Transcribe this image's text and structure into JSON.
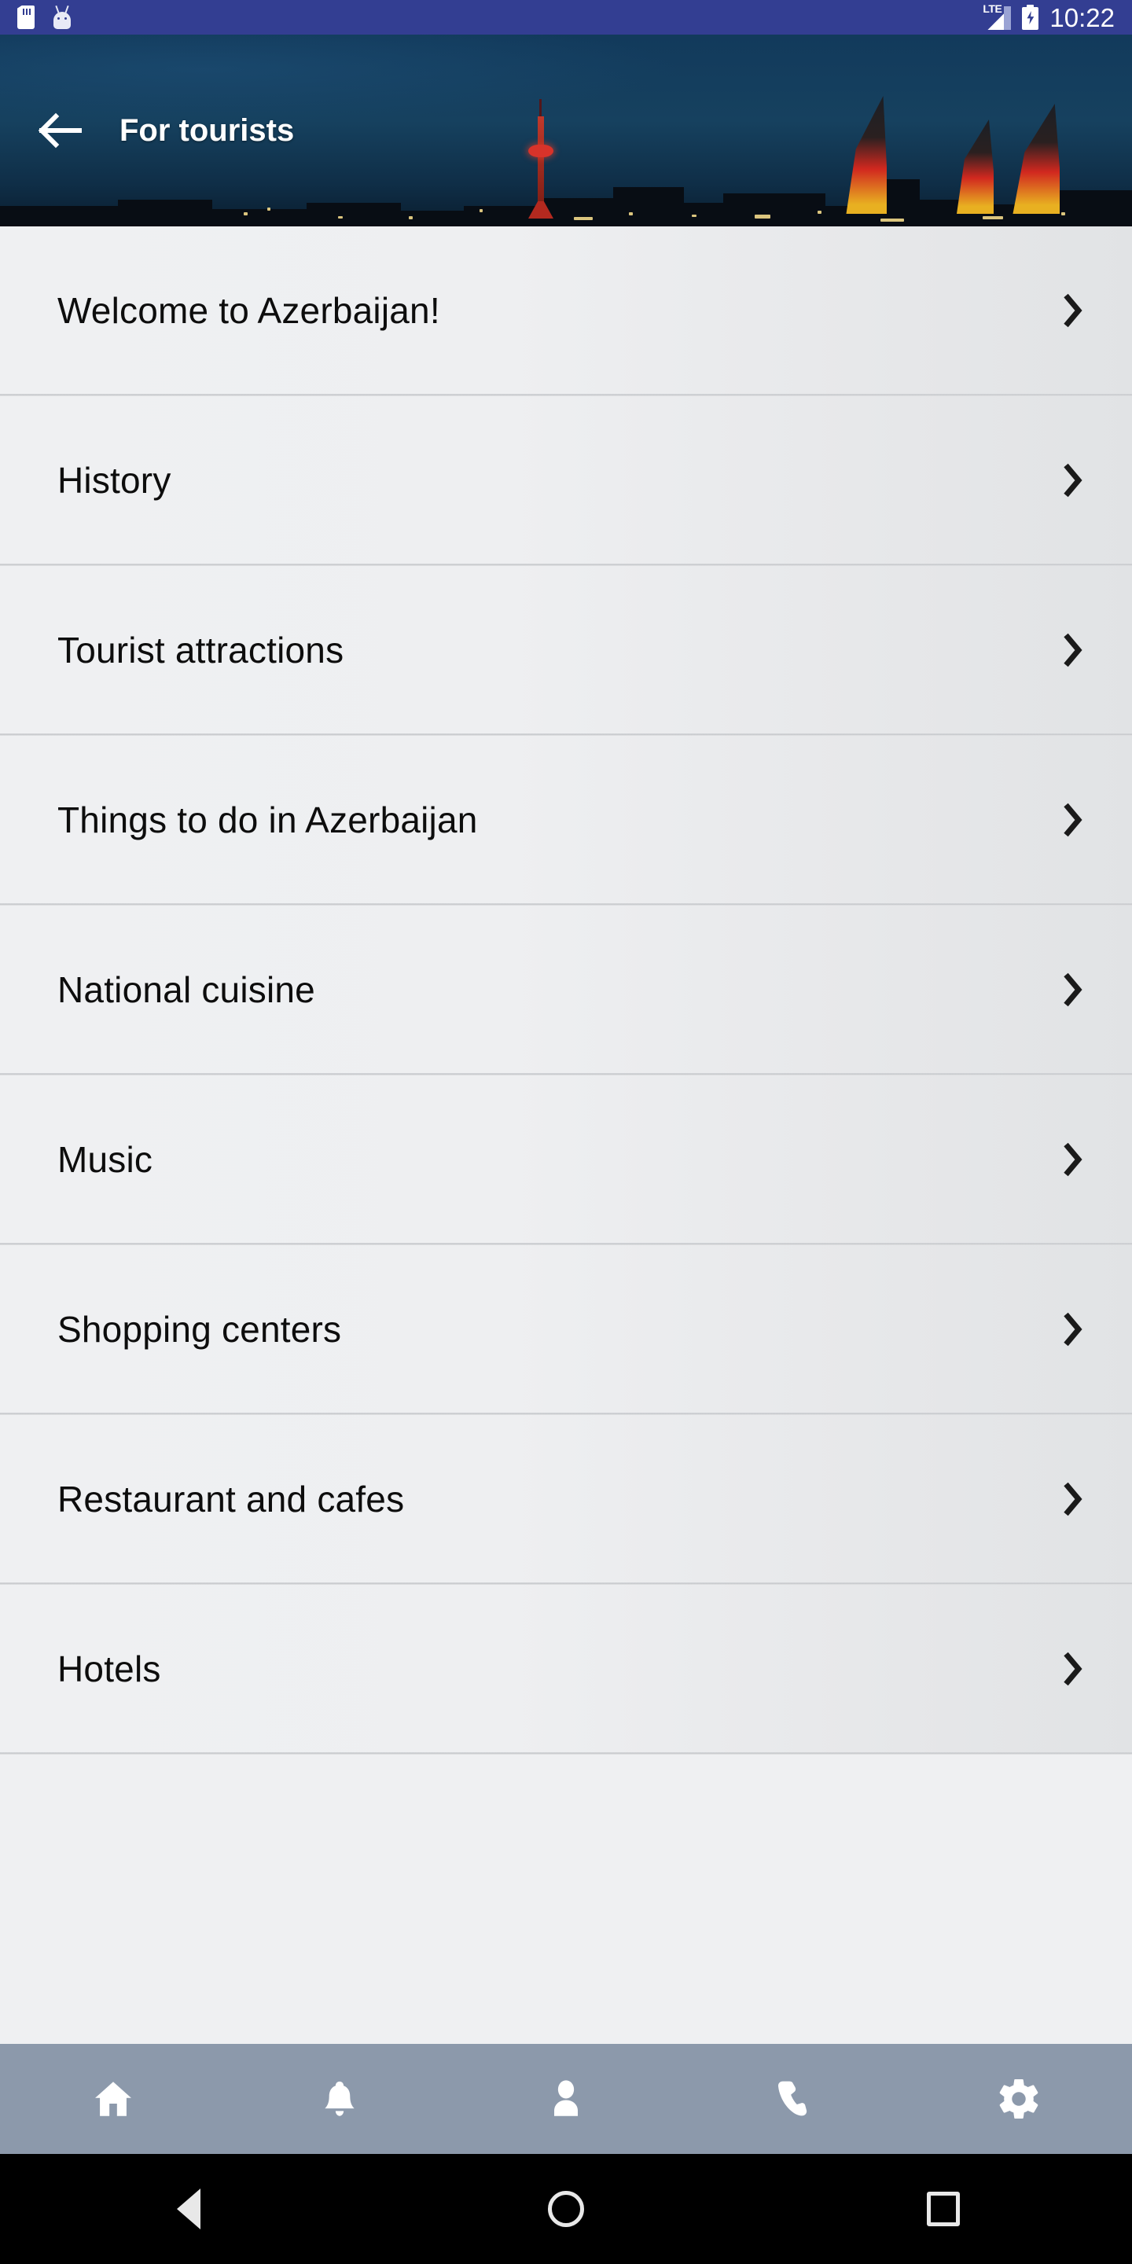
{
  "statusbar": {
    "time": "10:22",
    "network_label": "LTE",
    "icons": [
      "sd-card-icon",
      "android-mascot-icon",
      "signal-icon",
      "battery-charging-icon"
    ],
    "background_color": "#333e92"
  },
  "toolbar": {
    "title": "For tourists",
    "back_icon": "arrow-left-icon",
    "background_image_description": "Baku night skyline with TV Tower and Flame Towers",
    "background_color": "#123a5c"
  },
  "list": {
    "items": [
      {
        "label": "Welcome to Azerbaijan!",
        "chevron": "chevron-right-icon"
      },
      {
        "label": "History",
        "chevron": "chevron-right-icon"
      },
      {
        "label": "Tourist attractions",
        "chevron": "chevron-right-icon"
      },
      {
        "label": "Things to do in Azerbaijan",
        "chevron": "chevron-right-icon"
      },
      {
        "label": "National cuisine",
        "chevron": "chevron-right-icon"
      },
      {
        "label": "Music",
        "chevron": "chevron-right-icon"
      },
      {
        "label": "Shopping centers",
        "chevron": "chevron-right-icon"
      },
      {
        "label": "Restaurant and cafes",
        "chevron": "chevron-right-icon"
      },
      {
        "label": "Hotels",
        "chevron": "chevron-right-icon"
      }
    ]
  },
  "bottombar": {
    "background_color": "#8c99ab",
    "items": [
      {
        "icon": "home-icon",
        "name": "home"
      },
      {
        "icon": "bell-icon",
        "name": "notifications"
      },
      {
        "icon": "person-icon",
        "name": "profile"
      },
      {
        "icon": "phone-icon",
        "name": "contact"
      },
      {
        "icon": "gear-icon",
        "name": "settings"
      }
    ]
  },
  "navbar": {
    "items": [
      {
        "icon": "triangle-back-icon",
        "name": "back"
      },
      {
        "icon": "circle-home-icon",
        "name": "home"
      },
      {
        "icon": "square-recents-icon",
        "name": "recents"
      }
    ]
  },
  "colors": {
    "status_bar": "#333e92",
    "row_bg_light": "#eff0f2",
    "row_bg_dark": "#e1e3e5",
    "divider": "#c8cacd",
    "bottom_bar": "#8c99ab",
    "text": "#0d0d0d"
  }
}
